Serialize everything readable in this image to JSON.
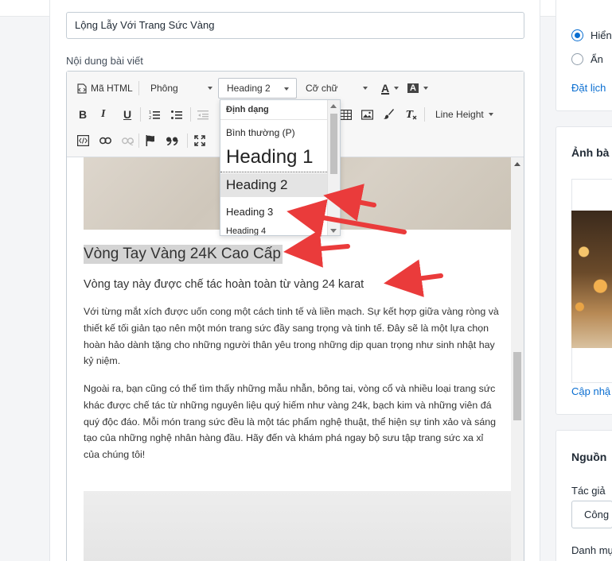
{
  "post": {
    "title_value": "Lộng Lẫy Với Trang Sức Vàng",
    "content_label": "Nội dung bài viết"
  },
  "toolbar": {
    "html_label": "Mã HTML",
    "font_label": "Phông",
    "heading_value": "Heading 2",
    "size_label": "Cỡ chữ",
    "text_color_letter": "A",
    "bg_color_letter": "A",
    "line_height_label": "Line Height",
    "bold": "B",
    "italic": "I",
    "underline": "U"
  },
  "format_dropdown": {
    "header": "Định dạng",
    "items": [
      "Bình thường (P)",
      "Heading 1",
      "Heading 2",
      "Heading 3",
      "Heading 4"
    ],
    "selected": "Heading 2"
  },
  "article": {
    "heading2": "Vòng Tay Vàng 24K Cao Cấp",
    "heading3": "Vòng tay này được chế tác hoàn toàn từ vàng 24 karat",
    "paragraph1": "Với từng mắt xích được uốn cong một cách tinh tế và liền mạch. Sự kết hợp giữa vàng ròng và thiết kế tối giản tạo nên một món trang sức đầy sang trọng và tinh tế. Đây sẽ là một lựa chọn hoàn hảo dành tặng cho những người thân yêu trong những dịp quan trọng như sinh nhật hay kỷ niệm.",
    "paragraph2": "Ngoài ra, bạn cũng có thể tìm thấy những mẫu nhẫn, bông tai, vòng cổ và nhiều loại trang sức khác được chế tác từ những nguyên liệu quý hiếm như vàng 24k, bạch kim và những viên đá quý độc đáo. Mỗi món trang sức đều là một tác phẩm nghệ thuật, thể hiện sự tinh xảo và sáng tạo của những nghệ nhân hàng đầu. Hãy đến và khám phá ngay bộ sưu tập trang sức xa xỉ của chúng tôi!"
  },
  "sidebar": {
    "visibility": {
      "show_label": "Hiển",
      "hide_label": "Ẩn",
      "schedule_link": "Đặt lịch"
    },
    "image": {
      "title": "Ảnh bà",
      "update_link": "Cập nhậ"
    },
    "source": {
      "title": "Nguồn",
      "author_label": "Tác giả",
      "author_value": "Công",
      "category_label": "Danh mụ"
    }
  },
  "colors": {
    "accent": "#0a6ed1",
    "annotation_arrow": "#ea3b3b"
  }
}
